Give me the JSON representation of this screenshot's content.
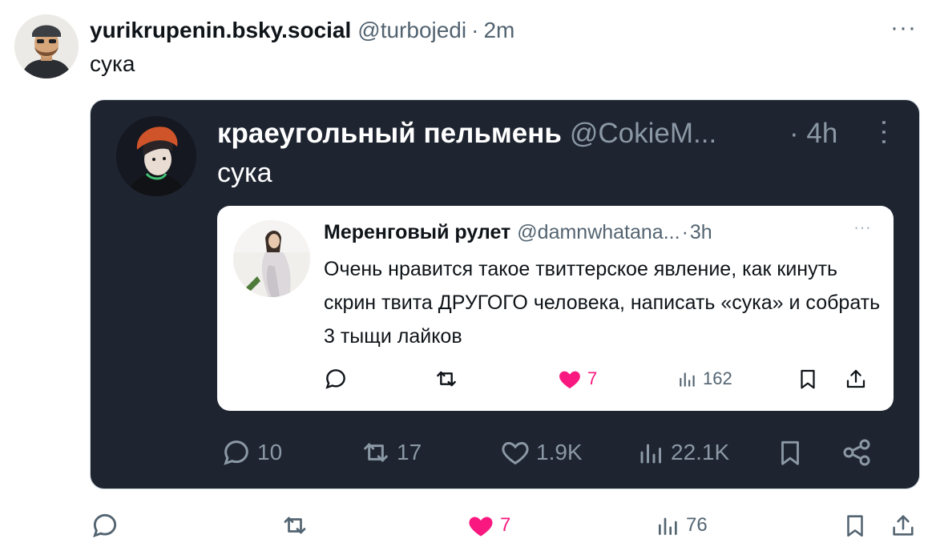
{
  "post": {
    "author_name": "yurikrupenin.bsky.social",
    "author_handle": "@turbojedi",
    "separator": "·",
    "time": "2m",
    "more": "···",
    "text": "сука",
    "actions": {
      "likes": "7",
      "views": "76",
      "liked": true
    }
  },
  "embed": {
    "author_name": "краеугольный пельмень",
    "author_handle": "@CokieM...",
    "time": "· 4h",
    "text": "сука",
    "actions": {
      "replies": "10",
      "reposts": "17",
      "likes": "1.9K",
      "views": "22.1K"
    },
    "quoted": {
      "author_name": "Меренговый рулет",
      "author_handle": "@damnwhatana...",
      "separator": "·",
      "time": "3h",
      "more": "···",
      "text": "Очень нравится такое твиттерское явление, как кинуть скрин твита ДРУГОГО человека, написать «сука» и собрать 3 тыщи лайков",
      "actions": {
        "likes": "7",
        "views": "162",
        "liked": true
      }
    }
  },
  "colors": {
    "like": "#f91880",
    "dark_card": "#1e2430",
    "muted": "#536471"
  },
  "icons": [
    "reply-icon",
    "repost-icon",
    "heart-icon",
    "views-icon",
    "bookmark-icon",
    "share-icon",
    "more-icon"
  ]
}
